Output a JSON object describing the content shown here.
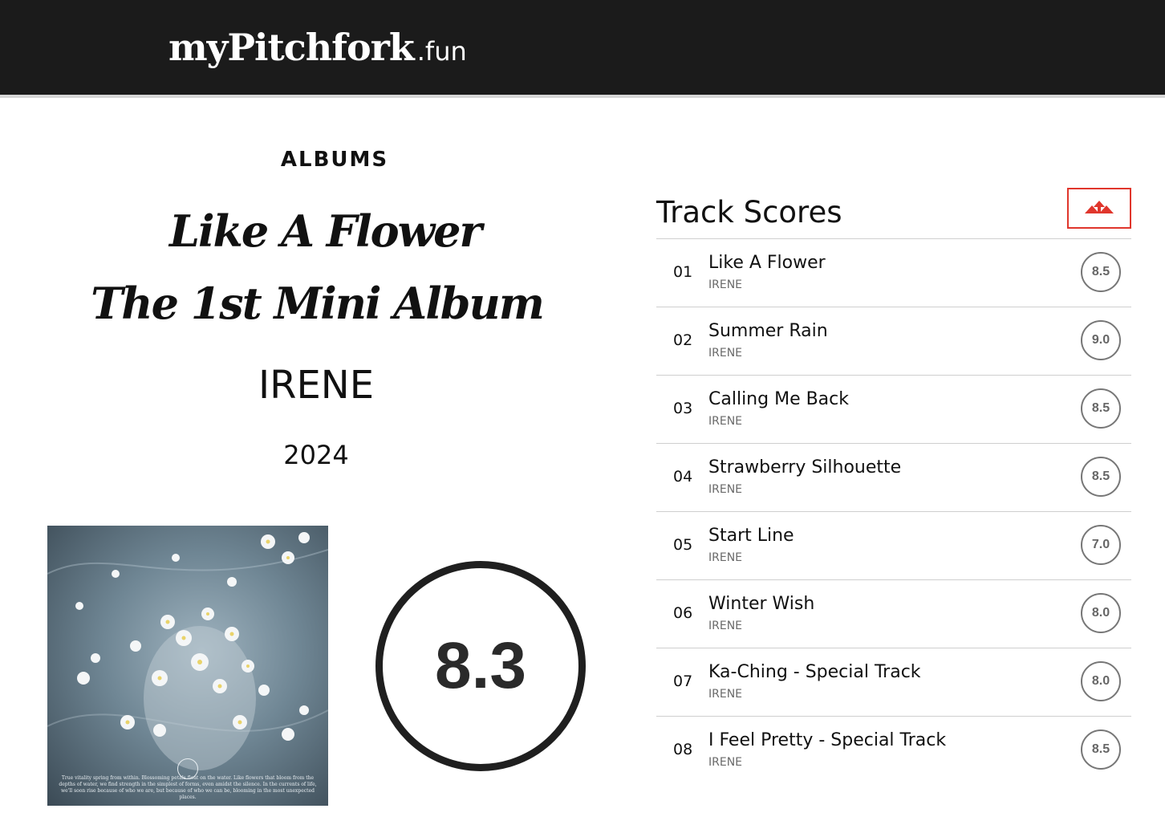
{
  "header": {
    "logo_main": "myPitchfork",
    "logo_sub": ".fun"
  },
  "album": {
    "kicker": "ALBUMS",
    "title_line1": "Like A Flower",
    "title_line2": "The 1st Mini  Album",
    "artist": "IRENE",
    "year": "2024",
    "score": "8.3",
    "cover_caption": "True vitality spring from within. Blossoming petals float on the water. Like flowers that bloom from the depths of water, we find strength in the simplest of forms, even amidst the silence. In the currents of life, we'll soon rise because of who we are, but because of who we can be, blooming in the most unexpected places."
  },
  "tracks_panel": {
    "title": "Track Scores",
    "sort_icon": "sort-arrows-icon",
    "accent_color": "#e0362c",
    "tracks": [
      {
        "num": "01",
        "title": "Like A Flower",
        "artist": "IRENE",
        "score": "8.5"
      },
      {
        "num": "02",
        "title": "Summer Rain",
        "artist": "IRENE",
        "score": "9.0"
      },
      {
        "num": "03",
        "title": "Calling Me Back",
        "artist": "IRENE",
        "score": "8.5"
      },
      {
        "num": "04",
        "title": "Strawberry Silhouette",
        "artist": "IRENE",
        "score": "8.5"
      },
      {
        "num": "05",
        "title": "Start Line",
        "artist": "IRENE",
        "score": "7.0"
      },
      {
        "num": "06",
        "title": "Winter Wish",
        "artist": "IRENE",
        "score": "8.0"
      },
      {
        "num": "07",
        "title": "Ka-Ching - Special Track",
        "artist": "IRENE",
        "score": "8.0"
      },
      {
        "num": "08",
        "title": "I Feel Pretty - Special Track",
        "artist": "IRENE",
        "score": "8.5"
      }
    ]
  }
}
